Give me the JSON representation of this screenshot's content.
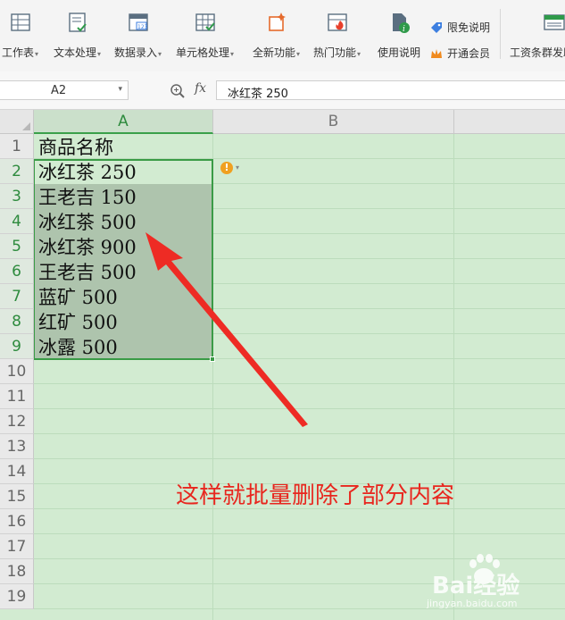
{
  "ribbon": {
    "buttons": [
      {
        "label": "工作表",
        "has_dropdown": true,
        "icon": "worksheet-icon"
      },
      {
        "label": "文本处理",
        "has_dropdown": true,
        "icon": "text-process-icon"
      },
      {
        "label": "数据录入",
        "has_dropdown": true,
        "icon": "data-entry-icon"
      },
      {
        "label": "单元格处理",
        "has_dropdown": true,
        "icon": "cell-process-icon"
      },
      {
        "label": "全新功能",
        "has_dropdown": true,
        "icon": "new-feature-icon"
      },
      {
        "label": "热门功能",
        "has_dropdown": true,
        "icon": "hot-feature-icon"
      },
      {
        "label": "使用说明",
        "has_dropdown": false,
        "icon": "manual-icon"
      },
      {
        "label": "工资条群发助",
        "has_dropdown": false,
        "icon": "payslip-icon"
      }
    ],
    "small_items": [
      {
        "label": "限免说明",
        "icon": "tag-icon",
        "color": "#3d7fe0"
      },
      {
        "label": "开通会员",
        "icon": "crown-icon",
        "color": "#f08a1e"
      }
    ]
  },
  "formula_bar": {
    "name_box": "A2",
    "fx_label": "fx",
    "formula_value": "冰红茶  250"
  },
  "sheet": {
    "columns": [
      "A",
      "B"
    ],
    "selected_column": "A",
    "rows": [
      "1",
      "2",
      "3",
      "4",
      "5",
      "6",
      "7",
      "8",
      "9",
      "10",
      "11",
      "12",
      "13",
      "14",
      "15",
      "16",
      "17",
      "18",
      "19"
    ],
    "selected_rows": [
      "2",
      "3",
      "4",
      "5",
      "6",
      "7",
      "8",
      "9"
    ],
    "cells_a": [
      "商品名称",
      "冰红茶  250",
      "王老吉  150",
      "冰红茶  500",
      "冰红茶  900",
      "王老吉  500",
      "蓝矿  500",
      "红矿  500",
      "冰露  500"
    ]
  },
  "annotation": {
    "text": "这样就批量删除了部分内容",
    "color": "#e8261e"
  },
  "watermark": {
    "brand": "Bai经验",
    "url": "jingyan.baidu.com"
  },
  "colors": {
    "grid_background": "#d2ebd1",
    "selection_border": "#3a9b46",
    "selection_fill": "#aec4ad"
  }
}
